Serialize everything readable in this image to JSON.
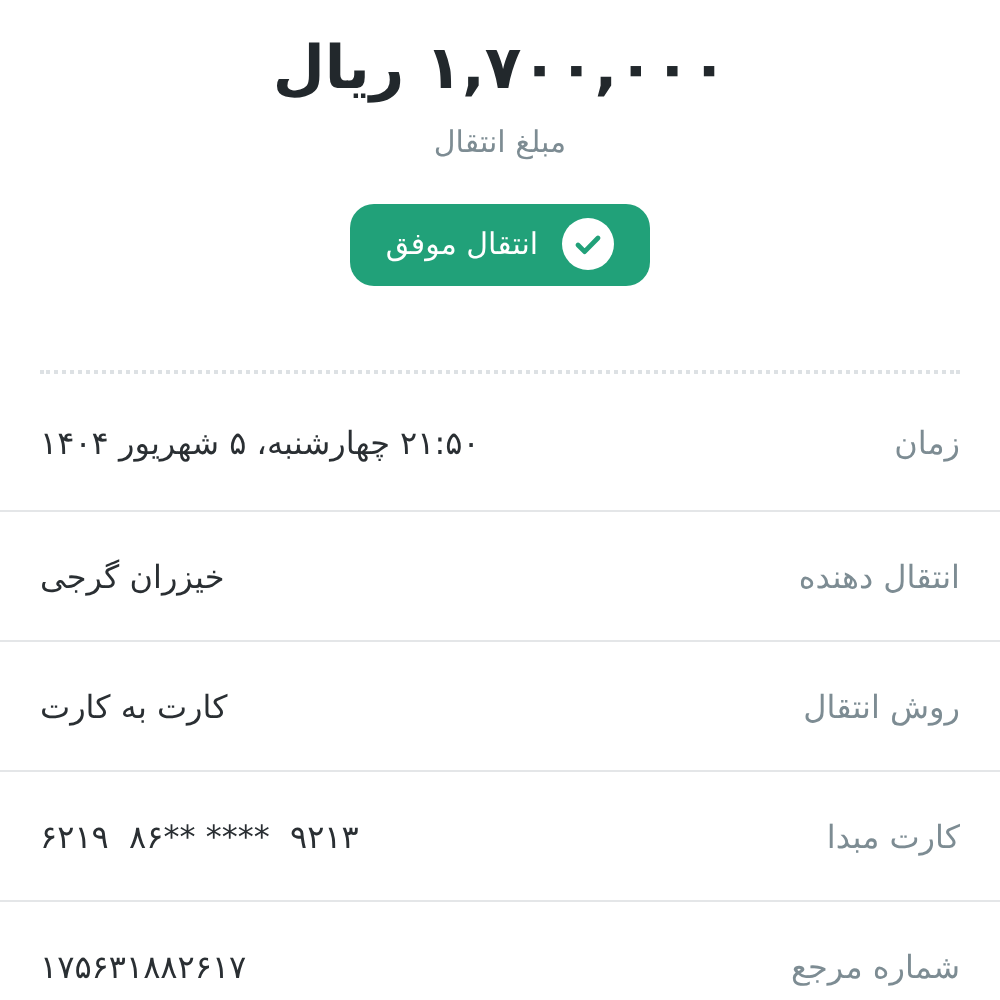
{
  "amount": "۱,۷۰۰,۰۰۰ ریال",
  "amount_label": "مبلغ انتقال",
  "status": {
    "label": "انتقال موفق",
    "kind": "success"
  },
  "details": [
    {
      "label": "زمان",
      "value": "۲۱:۵۰ چهارشنبه، ۵ شهریور ۱۴۰۴",
      "kind": "text"
    },
    {
      "label": "انتقال دهنده",
      "value": "خیزران گرجی",
      "kind": "text"
    },
    {
      "label": "روش انتقال",
      "value": "کارت به کارت",
      "kind": "text"
    },
    {
      "label": "کارت مبدا",
      "value": "۶۲۱۹  ۸۶** ****  ۹۲۱۳",
      "kind": "number"
    },
    {
      "label": "شماره مرجع",
      "value": "۱۷۵۶۳۱۸۸۲۶۱۷",
      "kind": "number"
    }
  ]
}
